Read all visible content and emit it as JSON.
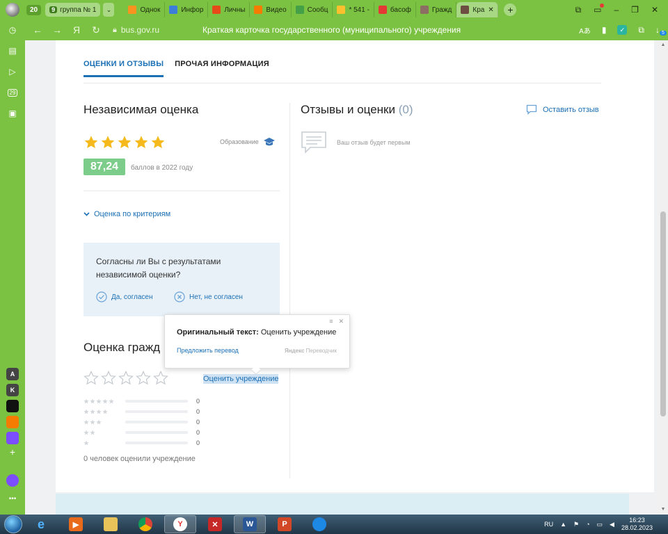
{
  "browser": {
    "tab_count": "20",
    "group": {
      "num": "9",
      "label": "группа № 1"
    },
    "tabs": [
      {
        "label": "Однок",
        "color": "#f7931e"
      },
      {
        "label": "Инфор",
        "color": "#3b7dd8"
      },
      {
        "label": "Личны",
        "color": "#e64a19"
      },
      {
        "label": "Видео",
        "color": "#f57c00"
      },
      {
        "label": "Сообц",
        "color": "#43a047"
      },
      {
        "label": "* 541 -",
        "color": "#fbc02d"
      },
      {
        "label": "басоф",
        "color": "#e53935"
      },
      {
        "label": "Гражд",
        "color": "#8d6e63"
      },
      {
        "label": "Кра",
        "color": "#6d4c41"
      }
    ],
    "url": "bus.gov.ru",
    "page_title": "Краткая карточка государственного (муниципального) учреждения",
    "download_badge": "5"
  },
  "sidebar": {
    "calendar_day": "29",
    "apps": [
      {
        "letter": "A",
        "color": "#444"
      },
      {
        "letter": "K",
        "color": "#444"
      },
      {
        "letter": "",
        "color": "#111"
      },
      {
        "letter": "",
        "color": "#f57c00"
      },
      {
        "letter": "",
        "color": "#7c4dff"
      }
    ]
  },
  "tabs": {
    "reviews": "ОЦЕНКИ И ОТЗЫВЫ",
    "other": "ПРОЧАЯ ИНФОРМАЦИЯ"
  },
  "independent": {
    "title": "Независимая оценка",
    "stars": 5,
    "category": "Образование",
    "score": "87,24",
    "score_caption": "баллов в 2022 году",
    "criteria_link": "Оценка по критериям",
    "question": "Согласны ли Вы с результатами независимой оценки?",
    "agree": "Да, согласен",
    "disagree": "Нет, не согласен"
  },
  "reviews": {
    "title": "Отзывы и оценки",
    "count": "(0)",
    "leave_link": "Оставить отзыв",
    "empty_text": "Ваш отзыв будет первым"
  },
  "citizens": {
    "title": "Оценка гражд",
    "rate_link": "Оценить учреждение",
    "distribution": [
      {
        "stars": 5,
        "count": "0"
      },
      {
        "stars": 4,
        "count": "0"
      },
      {
        "stars": 3,
        "count": "0"
      },
      {
        "stars": 2,
        "count": "0"
      },
      {
        "stars": 1,
        "count": "0"
      }
    ],
    "summary": "0 человек оценили учреждение"
  },
  "translate_popup": {
    "orig_label": "Оригинальный текст:",
    "orig_text": "Оценить учреждение",
    "suggest": "Предложить перевод",
    "brand_a": "Яндекс",
    "brand_b": "Переводчик"
  },
  "taskbar": {
    "lang": "RU",
    "time": "16:23",
    "date": "28.02.2023"
  },
  "colors": {
    "browser_green": "#7cc242",
    "link_blue": "#1a6fb5",
    "star_gold": "#f6b91b",
    "score_green": "#7ccc8a"
  }
}
